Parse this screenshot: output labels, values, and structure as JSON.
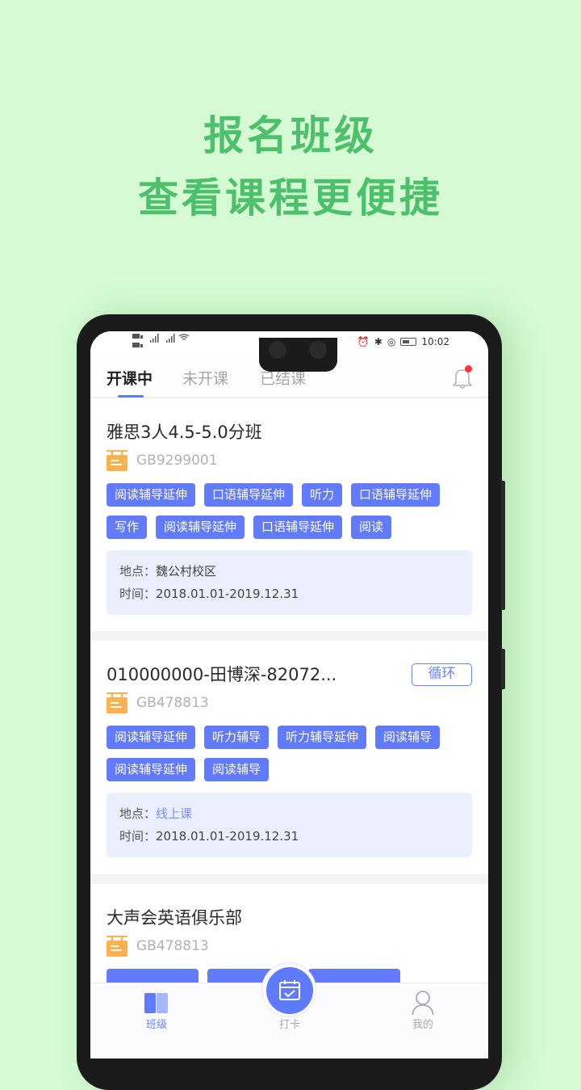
{
  "promo": {
    "line1": "报名班级",
    "line2": "查看课程更便捷",
    "color": "#4cc06a"
  },
  "statusbar": {
    "left": "HD 4G 4G",
    "time": "10:02"
  },
  "tabs": [
    {
      "label": "开课中",
      "active": true
    },
    {
      "label": "未开课",
      "active": false
    },
    {
      "label": "已结课",
      "active": false
    }
  ],
  "notification": {
    "icon": "bell-icon",
    "has_unread": true
  },
  "classes": [
    {
      "title": "雅思3人4.5-5.0分班",
      "code": "GB9299001",
      "tags": [
        "阅读辅导延伸",
        "口语辅导延伸",
        "听力",
        "口语辅导延伸",
        "写作",
        "阅读辅导延伸",
        "口语辅导延伸",
        "阅读"
      ],
      "location_label": "地点：",
      "location": "魏公村校区",
      "time_label": "时间：",
      "time": "2018.01.01-2019.12.31"
    },
    {
      "title": "010000000-田博深-82072...",
      "badge": "循环",
      "code": "GB478813",
      "tags": [
        "阅读辅导延伸",
        "听力辅导",
        "听力辅导延伸",
        "阅读辅导",
        "阅读辅导延伸",
        "阅读辅导"
      ],
      "location_label": "地点：",
      "location": "线上课",
      "time_label": "时间：",
      "time": "2018.01.01-2019.12.31"
    },
    {
      "title": "大声会英语俱乐部",
      "code": "GB478813",
      "tags": [
        "",
        "",
        "",
        ""
      ]
    }
  ],
  "bottom_nav": [
    {
      "label": "班级",
      "icon": "book-icon",
      "active": true
    },
    {
      "label": "打卡",
      "icon": "calendar-check-icon",
      "active": false
    },
    {
      "label": "我的",
      "icon": "user-icon",
      "active": false
    }
  ],
  "colors": {
    "accent": "#5e7bfd",
    "tag_bg": "#627afc",
    "info_bg": "#eaeefd",
    "code_icon": "#ffb14e",
    "notification_dot": "#ff3333"
  }
}
